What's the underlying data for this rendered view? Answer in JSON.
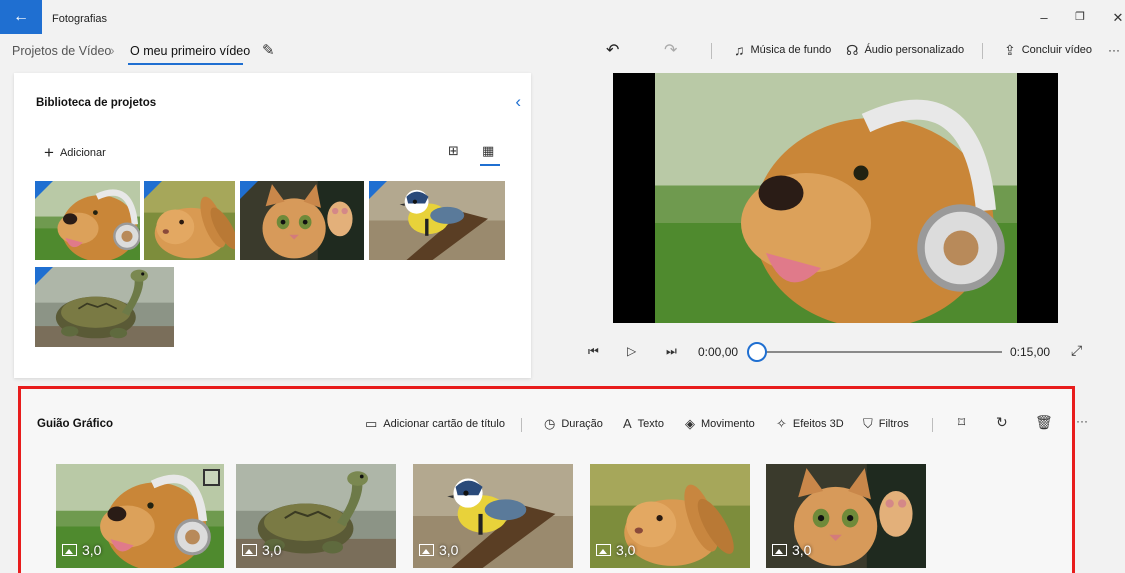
{
  "app": {
    "title": "Fotografias"
  },
  "window": {
    "minimize": "–",
    "maximize": "❐",
    "close": "✕"
  },
  "breadcrumb": {
    "parent": "Projetos de Vídeo",
    "separator": "›",
    "current": "O meu primeiro vídeo"
  },
  "toolbar": {
    "undo": "↶",
    "redo": "↷",
    "background_music": "Música de fundo",
    "custom_audio": "Áudio personalizado",
    "finish_video": "Concluir vídeo",
    "more": "···"
  },
  "library": {
    "title": "Biblioteca de projetos",
    "add_label": "Adicionar",
    "items": [
      "dog",
      "rabbit",
      "cat",
      "bird",
      "turtle"
    ]
  },
  "player": {
    "current_time": "0:00,00",
    "total_time": "0:15,00",
    "progress": 0
  },
  "storyboard": {
    "title": "Guião Gráfico",
    "actions": {
      "title_card": "Adicionar cartão de título",
      "duration": "Duração",
      "text": "Texto",
      "motion": "Movimento",
      "effects3d": "Efeitos 3D",
      "filters": "Filtros"
    },
    "more": "···",
    "clips": [
      {
        "subject": "dog",
        "duration": "3,0",
        "selected": true
      },
      {
        "subject": "turtle",
        "duration": "3,0",
        "selected": false
      },
      {
        "subject": "bird",
        "duration": "3,0",
        "selected": false
      },
      {
        "subject": "rabbit",
        "duration": "3,0",
        "selected": false
      },
      {
        "subject": "cat",
        "duration": "3,0",
        "selected": false
      }
    ]
  },
  "colors": {
    "accent": "#1f6fd1",
    "highlight": "#e81c1c"
  }
}
